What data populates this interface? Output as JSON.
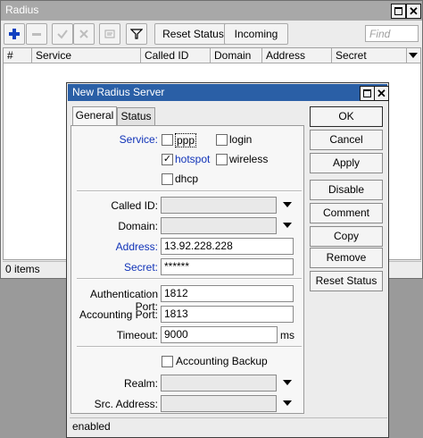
{
  "outer": {
    "title": "Radius",
    "toolbar": {
      "reset_status_label": "Reset Status",
      "incoming_label": "Incoming",
      "find_placeholder": "Find"
    },
    "columns": [
      "#",
      "Service",
      "Called ID",
      "Domain",
      "Address",
      "Secret"
    ],
    "status": "0 items"
  },
  "dialog": {
    "title": "New Radius Server",
    "tabs": [
      "General",
      "Status"
    ],
    "service": {
      "label": "Service:",
      "options": [
        {
          "label": "ppp",
          "checked": false
        },
        {
          "label": "login",
          "checked": false
        },
        {
          "label": "hotspot",
          "checked": true
        },
        {
          "label": "wireless",
          "checked": false
        },
        {
          "label": "dhcp",
          "checked": false
        }
      ]
    },
    "called_id": {
      "label": "Called ID:",
      "value": ""
    },
    "domain": {
      "label": "Domain:",
      "value": ""
    },
    "address": {
      "label": "Address:",
      "value": "13.92.228.228"
    },
    "secret": {
      "label": "Secret:",
      "value": "******"
    },
    "auth_port": {
      "label": "Authentication Port:",
      "value": "1812"
    },
    "acct_port": {
      "label": "Accounting Port:",
      "value": "1813"
    },
    "timeout": {
      "label": "Timeout:",
      "value": "9000",
      "unit": "ms"
    },
    "accounting_backup": {
      "label": "Accounting Backup",
      "checked": false
    },
    "realm": {
      "label": "Realm:",
      "value": ""
    },
    "src_address": {
      "label": "Src. Address:",
      "value": ""
    },
    "buttons": {
      "ok": "OK",
      "cancel": "Cancel",
      "apply": "Apply",
      "disable": "Disable",
      "comment": "Comment",
      "copy": "Copy",
      "remove": "Remove",
      "reset_status": "Reset Status"
    },
    "status": "enabled"
  },
  "colors": {
    "dialog_title_bar": "#2a5fa6",
    "accent_label": "#1033b8",
    "add_icon": "#1040c0"
  }
}
